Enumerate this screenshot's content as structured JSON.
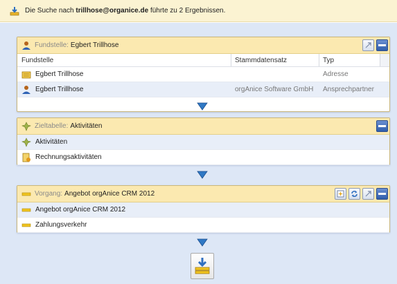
{
  "topbar": {
    "message_prefix": "Die Suche nach ",
    "search_term": "trillhose@organice.de",
    "message_suffix": " führte zu 2 Ergebnissen."
  },
  "panels": {
    "fundstelle": {
      "prefix": "Fundstelle:",
      "value": "Egbert Trillhose",
      "columns": [
        "Fundstelle",
        "Stammdatensatz",
        "Typ"
      ],
      "rows": [
        {
          "icon": "address-card-icon",
          "name": "Egbert Trillhose",
          "stamm": "",
          "typ": "Adresse"
        },
        {
          "icon": "person-icon",
          "name": "Egbert Trillhose",
          "stamm": "orgAnice Software GmbH",
          "typ": "Ansprechpartner"
        }
      ]
    },
    "zieltabelle": {
      "prefix": "Zieltabelle:",
      "value": "Aktivitäten",
      "rows": [
        {
          "icon": "activity-icon",
          "name": "Aktivitäten"
        },
        {
          "icon": "invoice-activity-icon",
          "name": "Rechnungsaktivitäten"
        }
      ]
    },
    "vorgang": {
      "prefix": "Vorgang:",
      "value": "Angebot orgAnice CRM 2012",
      "rows": [
        {
          "icon": "process-icon",
          "name": "Angebot orgAnice CRM 2012"
        },
        {
          "icon": "process-icon",
          "name": "Zahlungsverkehr"
        }
      ]
    }
  },
  "colors": {
    "canvas": "#dde7f6",
    "panel_header": "#fbe9b0",
    "alt_row": "#e8eef8",
    "arrow": "#2f78c4"
  }
}
